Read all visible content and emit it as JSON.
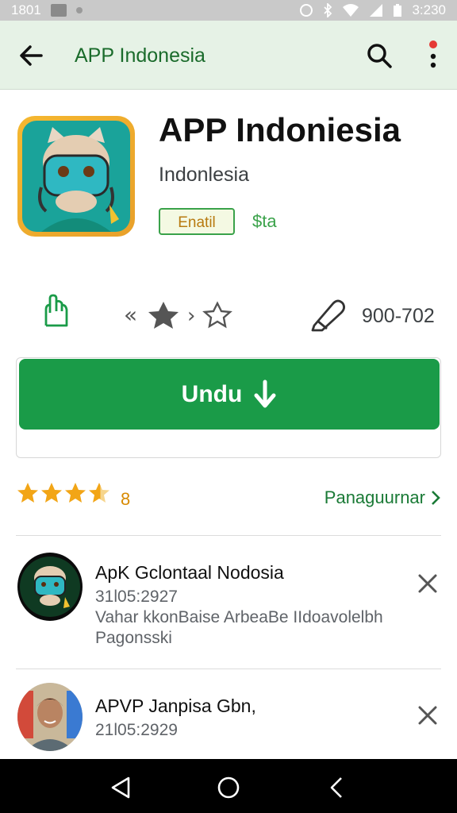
{
  "status_bar": {
    "time_left": "1801",
    "time_right": "3:230"
  },
  "app_bar": {
    "title": "APP Indonesia"
  },
  "app": {
    "name": "APP Indoniesia",
    "developer": "Indonlesia",
    "badge": "Enatil",
    "price": "$ta"
  },
  "meta": {
    "count": "900-702"
  },
  "install": {
    "label": "Undu"
  },
  "rating": {
    "value": "8",
    "reviews_link": "Panaguurnar"
  },
  "reviews": [
    {
      "title": "ApK Gclontaal Nodosia",
      "date": "31l05:2927",
      "text_1": "Vahar kkonBaise ArbeaBe IIdoavolelbh",
      "text_2": "Pagonsski"
    },
    {
      "title": "APVP Janpisa Gbn,",
      "date": "21l05:2929",
      "text_1": "",
      "text_2": ""
    }
  ],
  "colors": {
    "brand_green": "#1a9b48",
    "star": "#f2a516",
    "app_bar_bg": "#e6f2e6"
  }
}
